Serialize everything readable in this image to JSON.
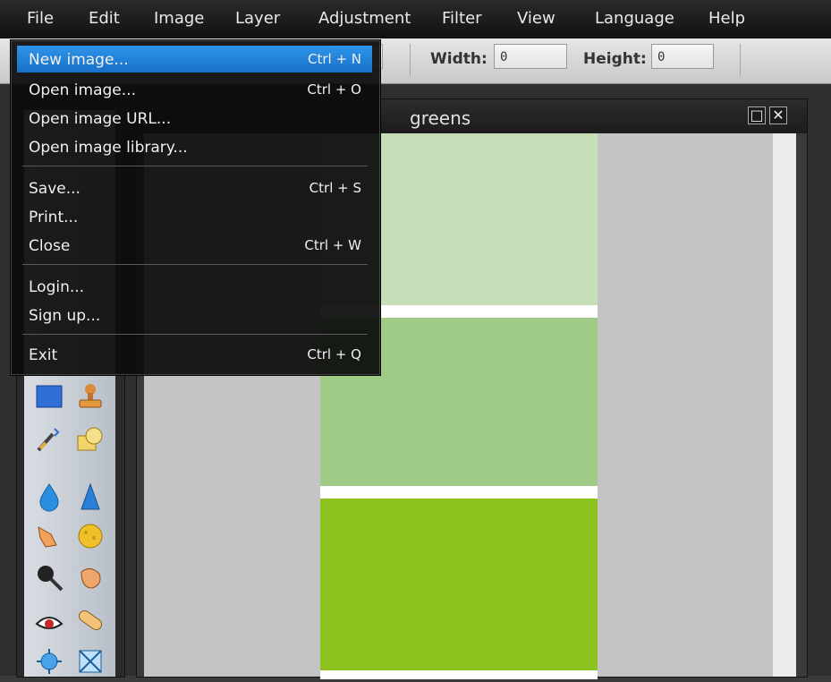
{
  "menubar": {
    "items": [
      "File",
      "Edit",
      "Image",
      "Layer",
      "Adjustment",
      "Filter",
      "View",
      "Language",
      "Help"
    ]
  },
  "toolbar": {
    "width_label": "Width:",
    "width_value": "0",
    "height_label": "Height:",
    "height_value": "0"
  },
  "image_window": {
    "title": "greens",
    "maximize_glyph": "□",
    "close_glyph": "✕"
  },
  "file_menu": {
    "items": [
      {
        "label": "New image...",
        "shortcut": "Ctrl + N"
      },
      {
        "label": "Open image...",
        "shortcut": "Ctrl + O"
      },
      {
        "label": "Open image URL...",
        "shortcut": ""
      },
      {
        "label": "Open image library...",
        "shortcut": ""
      },
      {
        "label": "Save...",
        "shortcut": "Ctrl + S"
      },
      {
        "label": "Print...",
        "shortcut": ""
      },
      {
        "label": "Close",
        "shortcut": "Ctrl + W"
      },
      {
        "label": "Login...",
        "shortcut": ""
      },
      {
        "label": "Sign up...",
        "shortcut": ""
      },
      {
        "label": "Exit",
        "shortcut": "Ctrl + Q"
      }
    ]
  },
  "colors": {
    "swatch_light": "#c6dfb9",
    "swatch_mid": "#9fcb86",
    "swatch_lime": "#8cc31e",
    "menu_highlight": "#1f82d8"
  },
  "tools": [
    "rectangle-select-icon",
    "stamp-icon",
    "replace-color-icon",
    "shape-icon",
    "blur-drop-icon",
    "sharpen-icon",
    "smudge-icon",
    "sponge-icon",
    "dodge-icon",
    "burn-icon",
    "red-eye-icon",
    "bandage-icon",
    "bloat-icon",
    "pinch-icon"
  ]
}
